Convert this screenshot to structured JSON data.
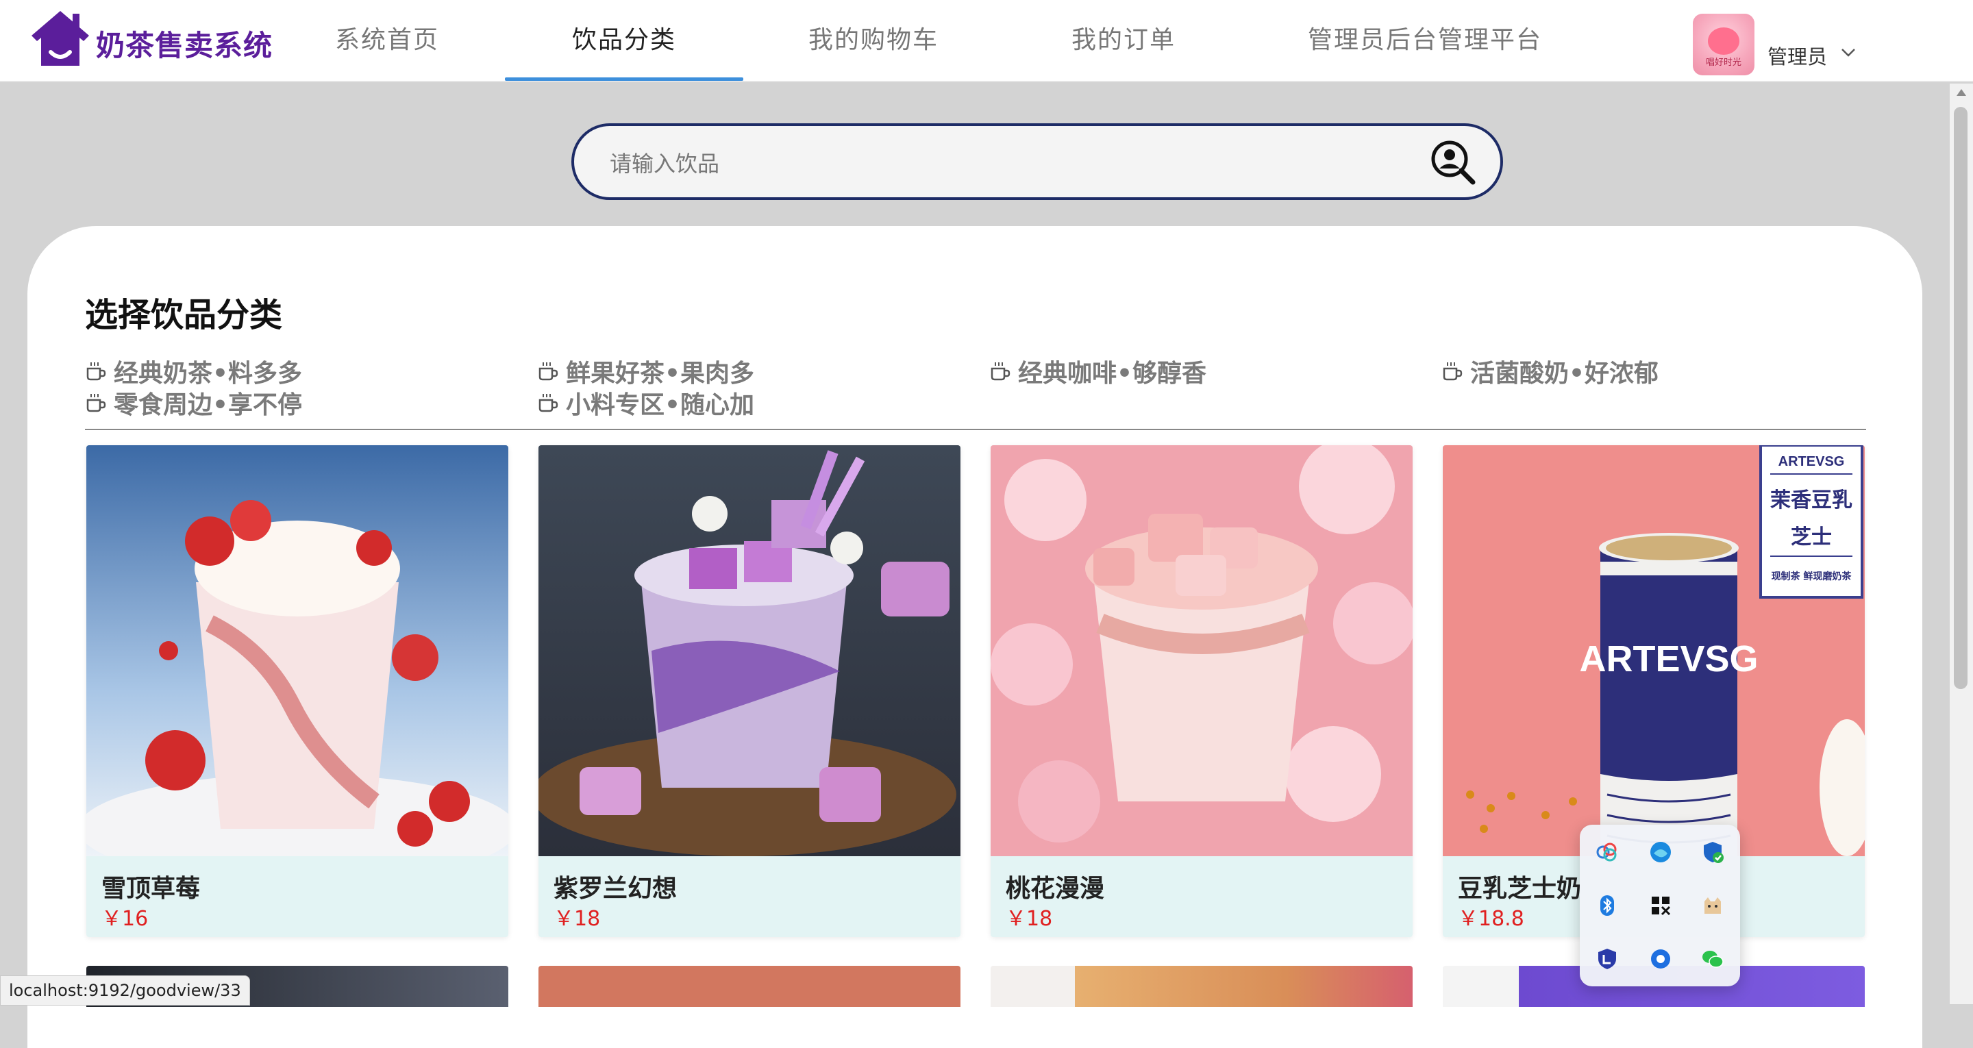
{
  "app": {
    "title": "奶茶售卖系统"
  },
  "nav": {
    "items": [
      {
        "label": "系统首页"
      },
      {
        "label": "饮品分类"
      },
      {
        "label": "我的购物车"
      },
      {
        "label": "我的订单"
      },
      {
        "label": "管理员后台管理平台"
      }
    ],
    "active_index": 1
  },
  "user": {
    "name": "管理员",
    "avatar_text": "唱好时光"
  },
  "search": {
    "placeholder": "请输入饮品",
    "value": ""
  },
  "section": {
    "title": "选择饮品分类"
  },
  "categories": [
    {
      "label": "经典奶茶•料多多"
    },
    {
      "label": "鲜果好茶•果肉多"
    },
    {
      "label": "经典咖啡•够醇香"
    },
    {
      "label": "活菌酸奶•好浓郁"
    },
    {
      "label": "零食周边•享不停"
    },
    {
      "label": "小料专区•随心加"
    }
  ],
  "products": [
    {
      "name": "雪顶草莓",
      "price": "￥16"
    },
    {
      "name": "紫罗兰幻想",
      "price": "￥18"
    },
    {
      "name": "桃花漫漫",
      "price": "￥18"
    },
    {
      "name": "豆乳芝士奶",
      "price": "￥18.8",
      "badge_brand": "ARTEVSG",
      "badge_line1": "茉香豆乳",
      "badge_line2": "芝士",
      "badge_footer": "现制茶 鲜现磨奶茶",
      "cup_brand": "ARTEVSG"
    }
  ],
  "tray": {
    "icons": [
      "cloud-sync-icon",
      "edge-icon",
      "security-shield-icon",
      "bluetooth-icon",
      "app-grid-icon",
      "cat-app-icon",
      "password-app-icon",
      "chat-bubble-icon",
      "wechat-icon"
    ]
  },
  "status": {
    "url": "localhost:9192/goodview/33"
  },
  "colors": {
    "brand": "#5b1e9b",
    "nav_underline": "#3d8fdc",
    "search_border": "#1d2b66",
    "price": "#e02020",
    "card_bg": "#e3f4f4"
  }
}
